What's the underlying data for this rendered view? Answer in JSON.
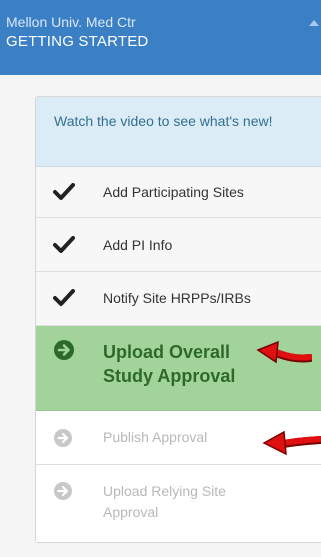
{
  "header": {
    "org": "Mellon Univ. Med Ctr",
    "title": "GETTING STARTED"
  },
  "card": {
    "info_text": "Watch the video to see what's new!",
    "steps": [
      {
        "label": "Add Participating Sites",
        "state": "done",
        "icon": "checkmark-icon"
      },
      {
        "label": "Add PI Info",
        "state": "done",
        "icon": "checkmark-icon"
      },
      {
        "label": "Notify Site HRPPs/IRBs",
        "state": "done",
        "icon": "checkmark-icon"
      },
      {
        "label": "Upload Overall Study Approval",
        "state": "current",
        "icon": "arrow-circle-right-icon"
      },
      {
        "label": "Publish Approval",
        "state": "pending",
        "icon": "arrow-circle-right-icon"
      },
      {
        "label": "Upload Relying Site Approval",
        "state": "pending",
        "icon": "arrow-circle-right-icon"
      }
    ]
  },
  "colors": {
    "header_bg": "#3b7fc4",
    "current_step_bg": "#a2d39a",
    "current_step_text": "#2d6a2a",
    "annotation_arrow": "#e01010"
  }
}
